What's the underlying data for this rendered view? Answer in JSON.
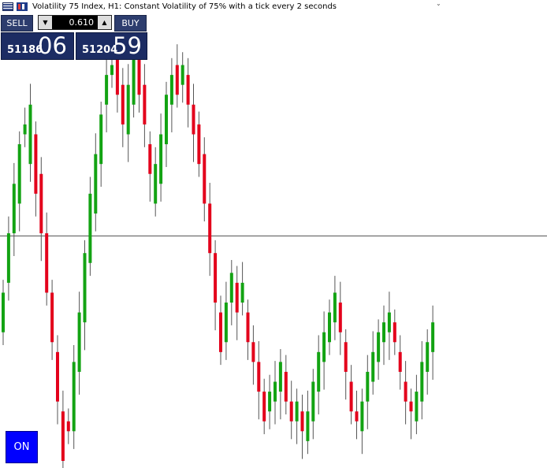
{
  "header": {
    "title": "Volatility 75 Index, H1:  Constant Volatility of 75% with a tick every 2 seconds"
  },
  "icons": {
    "menu": "chart-menu-icon",
    "app": "metatrader-icon"
  },
  "trade_panel": {
    "sell_label": "SELL",
    "buy_label": "BUY",
    "lot_value": "0.610",
    "lot_down_icon": "triangle-down-icon",
    "lot_up_icon": "triangle-up-icon",
    "sell_price_small": "51186",
    "sell_price_big": "06",
    "buy_price_small": "51204",
    "buy_price_big": "59"
  },
  "toggle": {
    "label": "ON"
  },
  "colors": {
    "bull": "#13a313",
    "bear": "#e3001b",
    "wick": "#555555",
    "panel": "#1c2c63",
    "on": "#0000ff"
  },
  "chart_data": {
    "type": "candlestick",
    "current_price": 51186.06,
    "candles": [
      [
        1,
        -5,
        -1,
        0
      ],
      [
        1,
        0,
        5,
        0
      ],
      [
        1,
        5,
        10,
        0
      ],
      [
        1,
        8,
        14,
        0
      ],
      [
        1,
        16,
        15,
        0
      ],
      [
        1,
        18,
        12,
        0
      ],
      [
        0,
        15,
        9,
        0
      ],
      [
        0,
        11,
        5,
        0
      ],
      [
        0,
        5,
        -1,
        0
      ],
      [
        0,
        -1,
        -6,
        0
      ],
      [
        0,
        -7,
        -12,
        0
      ],
      [
        0,
        -13,
        -18,
        0
      ],
      [
        0,
        -15,
        -14,
        0
      ],
      [
        1,
        -15,
        -8,
        0
      ],
      [
        1,
        -9,
        -3,
        0
      ],
      [
        1,
        -4,
        3,
        0
      ],
      [
        1,
        2,
        9,
        0
      ],
      [
        1,
        7,
        13,
        0
      ],
      [
        1,
        12,
        17,
        0
      ],
      [
        1,
        18,
        21,
        0
      ],
      [
        1,
        21,
        22,
        0
      ],
      [
        0,
        23,
        19,
        0
      ],
      [
        0,
        20,
        16,
        0
      ],
      [
        1,
        15,
        20,
        0
      ],
      [
        1,
        18,
        23,
        0
      ],
      [
        0,
        23,
        19,
        0
      ],
      [
        0,
        20,
        16,
        0
      ],
      [
        0,
        14,
        11,
        0
      ],
      [
        1,
        8,
        12,
        0
      ],
      [
        1,
        10,
        15,
        0
      ],
      [
        1,
        14,
        19,
        0
      ],
      [
        1,
        18,
        21,
        0
      ],
      [
        0,
        22,
        19,
        0
      ],
      [
        1,
        20,
        22,
        0
      ],
      [
        0,
        21,
        18,
        0
      ],
      [
        0,
        18,
        15,
        0
      ],
      [
        0,
        16,
        12,
        0
      ],
      [
        0,
        13,
        8,
        0
      ],
      [
        0,
        8,
        3,
        0
      ],
      [
        0,
        3,
        -2,
        0
      ],
      [
        0,
        -3,
        -7,
        0
      ],
      [
        1,
        -6,
        -2,
        0
      ],
      [
        1,
        -2,
        1,
        0
      ],
      [
        0,
        0,
        -3,
        0
      ],
      [
        1,
        -2,
        0,
        0
      ],
      [
        0,
        -3,
        -6,
        0
      ],
      [
        0,
        -6,
        -8,
        0
      ],
      [
        0,
        -8,
        -11,
        0
      ],
      [
        0,
        -11,
        -14,
        0
      ],
      [
        1,
        -13,
        -11,
        0
      ],
      [
        1,
        -12,
        -10,
        0
      ],
      [
        1,
        -11,
        -8,
        0
      ],
      [
        0,
        -9,
        -12,
        0
      ],
      [
        0,
        -12,
        -14,
        0
      ],
      [
        1,
        -14,
        -12,
        0
      ],
      [
        0,
        -13,
        -15,
        0
      ],
      [
        1,
        -16,
        -13,
        0
      ],
      [
        1,
        -14,
        -10,
        0
      ],
      [
        1,
        -11,
        -7,
        0
      ],
      [
        1,
        -8,
        -5,
        0
      ],
      [
        1,
        -6,
        -3,
        0
      ],
      [
        1,
        -4,
        -1,
        0
      ],
      [
        0,
        -2,
        -5,
        0
      ],
      [
        0,
        -6,
        -9,
        0
      ],
      [
        0,
        -10,
        -13,
        0
      ],
      [
        0,
        -13,
        -14,
        0
      ],
      [
        1,
        -15,
        -12,
        0
      ],
      [
        1,
        -12,
        -9,
        0
      ],
      [
        1,
        -10,
        -7,
        0
      ],
      [
        1,
        -8,
        -5,
        0
      ],
      [
        1,
        -6,
        -4,
        0
      ],
      [
        1,
        -5,
        -3,
        0
      ],
      [
        0,
        -4,
        -6,
        0
      ],
      [
        0,
        -7,
        -9,
        0
      ],
      [
        0,
        -10,
        -12,
        0
      ],
      [
        0,
        -12,
        -13,
        0
      ],
      [
        1,
        -14,
        -11,
        0
      ],
      [
        1,
        -12,
        -8,
        0
      ],
      [
        1,
        -9,
        -6,
        0
      ],
      [
        1,
        -7,
        -4,
        0
      ]
    ]
  }
}
